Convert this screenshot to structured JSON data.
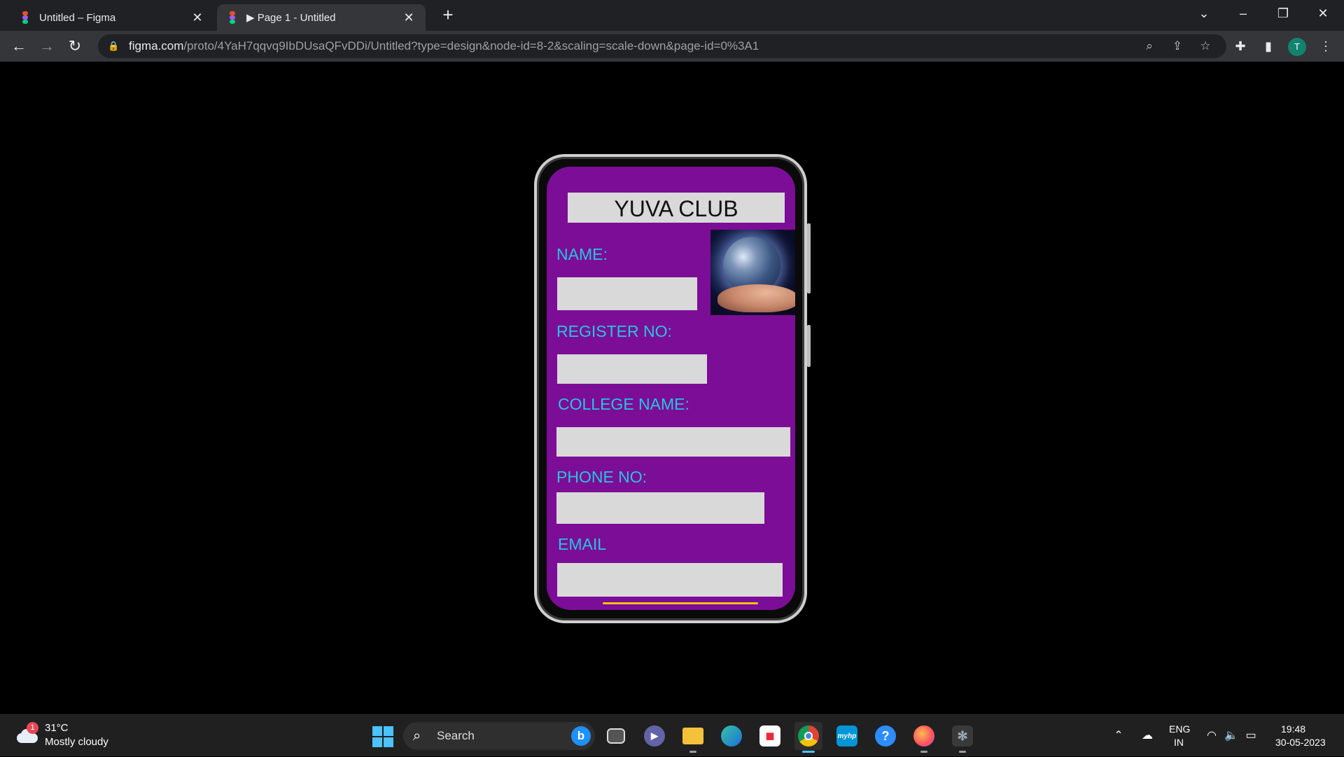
{
  "browser": {
    "tabs": [
      {
        "title": "Untitled – Figma",
        "active": false
      },
      {
        "title": "▶ Page 1 - Untitled",
        "active": true
      }
    ],
    "new_tab_icon": "plus-icon",
    "url_host": "figma.com",
    "url_path": "/proto/4YaH7qqvq9IbDUsaQFvDDi/Untitled?type=design&node-id=8-2&scaling=scale-down&page-id=0%3A1",
    "profile_initial": "T",
    "profile_color": "#12836f"
  },
  "app": {
    "title": "YUVA CLUB",
    "background": "#7c0d97",
    "label_color": "#25c6de",
    "fields": [
      {
        "label": "NAME:",
        "value": ""
      },
      {
        "label": "REGISTER NO:",
        "value": ""
      },
      {
        "label": "COLLEGE NAME:",
        "value": ""
      },
      {
        "label": "PHONE NO:",
        "value": ""
      },
      {
        "label": "EMAIL",
        "value": ""
      }
    ],
    "photo_icon": "earth-in-hand-image"
  },
  "taskbar": {
    "weather_badge": "1",
    "weather_temp": "31°C",
    "weather_desc": "Mostly cloudy",
    "search_placeholder": "Search",
    "lang_line1": "ENG",
    "lang_line2": "IN",
    "time": "19:48",
    "date": "30-05-2023"
  }
}
